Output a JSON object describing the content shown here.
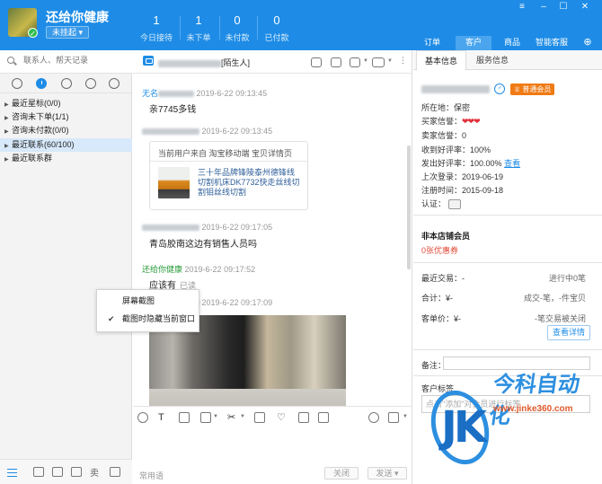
{
  "header": {
    "store_name": "还给你健康",
    "status_label": "未挂起",
    "stats": [
      {
        "value": "1",
        "label": "今日接待"
      },
      {
        "value": "1",
        "label": "未下单"
      },
      {
        "value": "0",
        "label": "未付款"
      },
      {
        "value": "0",
        "label": "已付款"
      }
    ],
    "tabs": [
      {
        "label": "订单",
        "active": false
      },
      {
        "label": "客户",
        "active": true
      },
      {
        "label": "商品",
        "active": false
      },
      {
        "label": "智能客服",
        "active": false
      }
    ],
    "accent_color": "#1e8ce6"
  },
  "left": {
    "search_placeholder": "联系人、帮天记录",
    "filter_icons": [
      "chat-icon",
      "clock-icon",
      "user-icon",
      "group-icon",
      "org-icon"
    ],
    "tree": [
      {
        "label": "最近星标(0/0)",
        "expanded": false,
        "selected": false
      },
      {
        "label": "咨询未下单(1/1)",
        "expanded": false,
        "selected": false
      },
      {
        "label": "咨询未付款(0/0)",
        "expanded": false,
        "selected": false
      },
      {
        "label": "最近联系(60/100)",
        "expanded": false,
        "selected": true
      },
      {
        "label": "最近联系群",
        "expanded": false,
        "selected": false
      }
    ],
    "bottom_glyph": "卖"
  },
  "chat": {
    "contact_suffix": "[陌生人]",
    "messages": [
      {
        "sender": "无名",
        "time": "2019-6-22 09:13:45",
        "text": "亲7745多钱"
      },
      {
        "sender": "",
        "time": "2019-6-22 09:13:45",
        "card": {
          "from": "当前用户来自 淘宝移动端 宝贝详情页",
          "title": "三十年品牌锋陵泰州德锋线切割机床DK7732快走丝线切割钼丝线切割"
        }
      },
      {
        "sender": "",
        "time": "2019-6-22 09:17:05",
        "text": "青岛胶南这边有销售人员吗"
      },
      {
        "sender": "还给你健康",
        "time": "2019-6-22 09:17:52",
        "text": "应该有",
        "read": "已读"
      },
      {
        "sender": "",
        "time": "2019-6-22 09:17:09",
        "image": true
      }
    ],
    "context_menu": [
      {
        "label": "屏幕截图",
        "checked": false
      },
      {
        "label": "截图时隐藏当前窗口",
        "checked": true
      }
    ],
    "common_phrases": "常用语",
    "close_label": "关闭",
    "send_label": "发送"
  },
  "right": {
    "tabs": [
      {
        "label": "基本信息",
        "active": true
      },
      {
        "label": "服务信息",
        "active": false
      }
    ],
    "vip_badge": "普通会员",
    "info": [
      {
        "label": "所在地：",
        "value": "保密"
      },
      {
        "label": "买家信誉：",
        "value": ""
      },
      {
        "label": "卖家信誉：",
        "value": "0"
      },
      {
        "label": "收到好评率：",
        "value": "100%"
      },
      {
        "label": "发出好评率：",
        "value": "100.00%",
        "link": "查看"
      },
      {
        "label": "上次登录：",
        "value": "2019-06-19"
      },
      {
        "label": "注册时间：",
        "value": "2015-09-18"
      },
      {
        "label": "认证：",
        "value": ""
      }
    ],
    "member_title": "非本店铺会员",
    "coupon_text": "0张优惠券",
    "recent_trade_label": "最近交易：-",
    "recent_trade_status": "进行中0笔",
    "total_label": "合计：¥-",
    "total_detail": "成交-笔，-件宝贝",
    "avg_label": "客单价：¥-",
    "avg_detail": "-笔交易被关闭",
    "detail_button": "查看详情",
    "note_label": "备注：",
    "tag_title": "客户标签",
    "tag_placeholder": "点击\"添加\"对会员进行标签"
  },
  "watermark": {
    "logo_text": "JK",
    "brand": "今科自动化",
    "url": "www.jinke360.com"
  }
}
